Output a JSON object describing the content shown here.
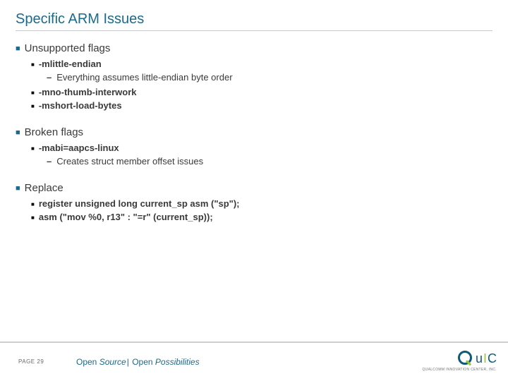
{
  "title": "Specific ARM Issues",
  "sections": [
    {
      "heading": "Unsupported flags",
      "items": [
        {
          "label": "-mlittle-endian",
          "sub": "Everything assumes little-endian byte order"
        },
        {
          "label": "-mno-thumb-interwork"
        },
        {
          "label": "-mshort-load-bytes"
        }
      ]
    },
    {
      "heading": "Broken flags",
      "items": [
        {
          "label": "-mabi=aapcs-linux",
          "sub": "Creates struct member offset issues"
        }
      ]
    },
    {
      "heading": "Replace",
      "items": [
        {
          "label": "register unsigned long current_sp asm (\"sp\");"
        },
        {
          "label": "asm (\"mov %0, r13\" : \"=r\" (current_sp));"
        }
      ]
    }
  ],
  "footer": {
    "page_label": "PAGE",
    "page_number": "29",
    "tagline_a": "Open ",
    "tagline_b": "Source",
    "tagline_c": " Open ",
    "tagline_d": "Possibilities",
    "logo_sub": "QUALCOMM INNOVATION CENTER, INC."
  }
}
